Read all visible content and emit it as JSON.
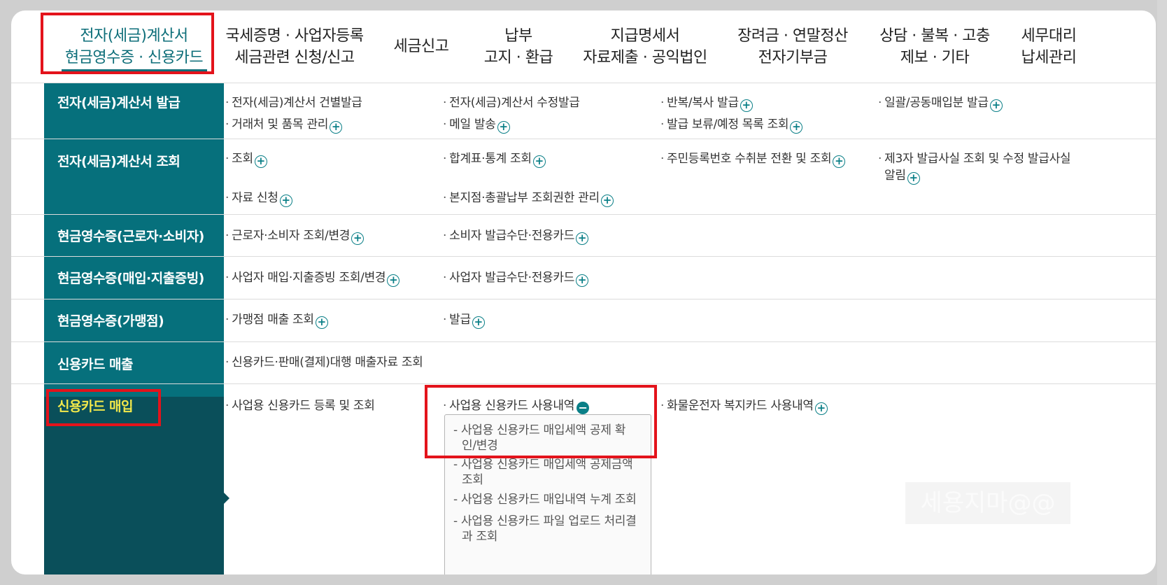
{
  "top_nav": [
    {
      "line1": "전자(세금)계산서",
      "line2": "현금영수증 · 신용카드"
    },
    {
      "line1": "국세증명 · 사업자등록",
      "line2": "세금관련 신청/신고"
    },
    {
      "line1": "세금신고",
      "line2": ""
    },
    {
      "line1": "납부",
      "line2": "고지 · 환급"
    },
    {
      "line1": "지급명세서",
      "line2": "자료제출 · 공익법인"
    },
    {
      "line1": "장려금 · 연말정산",
      "line2": "전자기부금"
    },
    {
      "line1": "상담 · 불복 · 고충",
      "line2": "제보 · 기타"
    },
    {
      "line1": "세무대리",
      "line2": "납세관리"
    }
  ],
  "rows": [
    {
      "label": "전자(세금)계산서 발급",
      "links": [
        "전자(세금)계산서 건별발급",
        "전자(세금)계산서 수정발급",
        "반복/복사 발급",
        "일괄/공동매입분 발급",
        "거래처 및 품목 관리",
        "메일 발송",
        "발급 보류/예정 목록 조회"
      ]
    },
    {
      "label": "전자(세금)계산서 조회",
      "links": [
        "조회",
        "합계표·통계 조회",
        "주민등록번호 수취분 전환 및 조회",
        "제3자 발급사실 조회 및 수정 발급사실",
        "알림",
        "자료 신청",
        "본지점·총괄납부 조회권한 관리"
      ]
    },
    {
      "label": "현금영수증(근로자·소비자)",
      "links": [
        "근로자·소비자 조회/변경",
        "소비자 발급수단·전용카드"
      ]
    },
    {
      "label": "현금영수증(매입·지출증빙)",
      "links": [
        "사업자 매입·지출증빙 조회/변경",
        "사업자 발급수단·전용카드"
      ]
    },
    {
      "label": "현금영수증(가맹점)",
      "links": [
        "가맹점 매출 조회",
        "발급"
      ]
    },
    {
      "label": "신용카드 매출",
      "links": [
        "신용카드·판매(결제)대행 매출자료 조회"
      ]
    },
    {
      "label": "신용카드 매입",
      "links": [
        "사업용 신용카드 등록 및 조회",
        "사업용 신용카드 사용내역",
        "화물운전자 복지카드 사용내역"
      ]
    }
  ],
  "submenu": [
    "사업용 신용카드 매입세액 공제 확인/변경",
    "사업용 신용카드 매입세액 공제금액 조회",
    "사업용 신용카드 매입내역 누계 조회",
    "사업용 신용카드 파일 업로드 처리결과 조회"
  ],
  "submenu_lines": [
    [
      "사업용 신용카드 매입세액 공제 확",
      "인/변경"
    ],
    [
      "사업용 신용카드 매입세액 공제금액",
      "조회"
    ],
    [
      "사업용 신용카드 매입내역 누계 조회",
      ""
    ],
    [
      "사업용 신용카드 파일 업로드 처리결",
      "과 조회"
    ]
  ],
  "watermark": "세용지마@@",
  "colors": {
    "accent": "#06707c",
    "dark": "#0a4f5a",
    "highlight": "#e3131b",
    "label_highlight": "#f2e84a"
  }
}
